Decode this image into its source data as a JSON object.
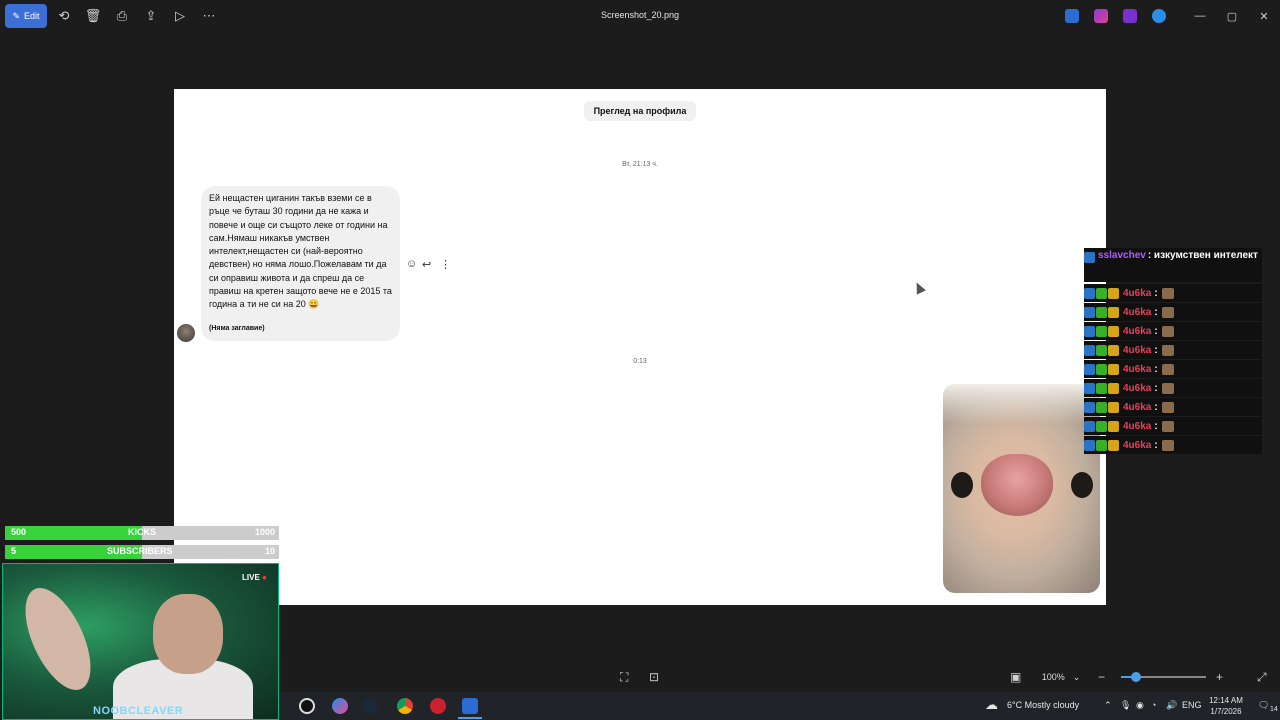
{
  "titlebar": {
    "edit_label": "Edit",
    "file_name": "Screenshot_20.png",
    "icons": [
      "rotate-icon",
      "delete-icon",
      "print-icon",
      "share-icon",
      "slideshow-icon",
      "more-icon"
    ]
  },
  "canvas": {
    "profile_button": "Преглед на профила",
    "timestamp_top": "Вт, 21:13 ч.",
    "message": "Ей нещастен циганин такъв вземи се в ръце че буташ 30 години да не кажа и повече и още си същото леке  от години на сам.Нямаш никакъв умствен интелект,нещастен  си (най-вероятно девствен) но няма лошо.Пожелавам ти да си оправиш живота и да спреш да се правиш на кретен защото вече не е 2015 та година а ти не си на 20 😀",
    "attachment_label": "(Няма заглавие)",
    "timestamp_bottom": "0:13"
  },
  "chat": {
    "first_user": "sslavchev",
    "first_message": ": изкумствен интелект",
    "rows": [
      {
        "user": "4u6ka",
        "sep": ":"
      },
      {
        "user": "4u6ka",
        "sep": ":"
      },
      {
        "user": "4u6ka",
        "sep": ":"
      },
      {
        "user": "4u6ka",
        "sep": ":"
      },
      {
        "user": "4u6ka",
        "sep": ":"
      },
      {
        "user": "4u6ka",
        "sep": ":"
      },
      {
        "user": "4u6ka",
        "sep": ":"
      },
      {
        "user": "4u6ka",
        "sep": ":"
      },
      {
        "user": "4u6ka",
        "sep": ":"
      }
    ]
  },
  "stream_overlay": {
    "kicks_current": "500",
    "kicks_label": "KICKS",
    "kicks_goal": "1000",
    "kicks_progress": 0.5,
    "subs_current": "5",
    "subs_label": "SUBSCRIBERS",
    "subs_goal": "10",
    "subs_progress": 0.5,
    "live_label": "LIVE",
    "streamer_name": "NOOBCLEAVER"
  },
  "bottombar": {
    "zoom_level": "100%"
  },
  "taskbar": {
    "weather": "6°C  Mostly cloudy",
    "language": "ENG",
    "time": "12:14 AM",
    "date": "1/7/2026",
    "notifications": "14"
  },
  "colors": {
    "accent": "#3b6fd6",
    "canvas_bg": "#ffffff",
    "chat_nick": "#e83f5a",
    "goal_fill": "#38d33a"
  }
}
